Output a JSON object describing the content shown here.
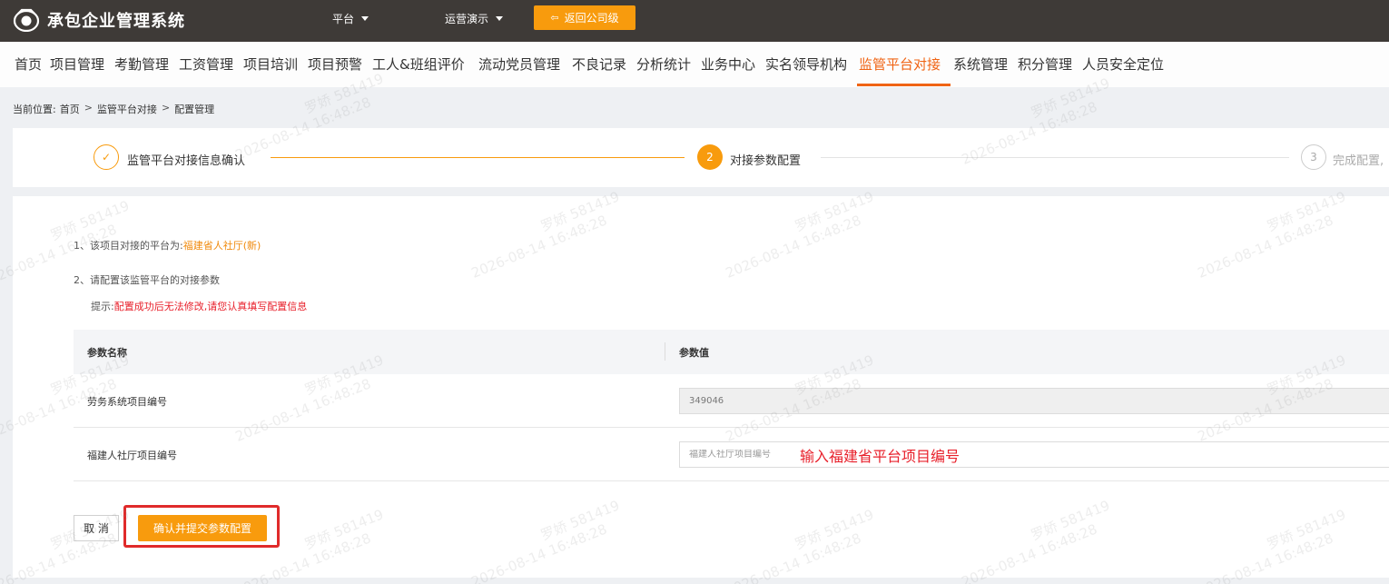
{
  "app": {
    "title": "承包企业管理系统",
    "logo_icon": "camera-logo-icon"
  },
  "topbar": {
    "platform_label": "平台",
    "demo_label": "运营演示",
    "back_button": "返回公司级"
  },
  "nav": {
    "items": [
      "首页",
      "项目管理",
      "考勤管理",
      "工资管理",
      "项目培训",
      "项目预警",
      "工人&班组评价",
      "流动党员管理",
      "不良记录",
      "分析统计",
      "业务中心",
      "实名领导机构",
      "监管平台对接",
      "系统管理",
      "积分管理",
      "人员安全定位"
    ],
    "active_index": 12
  },
  "breadcrumb": {
    "prefix": "当前位置:",
    "items": [
      "首页",
      "监管平台对接",
      "配置管理"
    ],
    "separator": ">"
  },
  "steps": [
    {
      "number": "✓",
      "label": "监管平台对接信息确认",
      "state": "done"
    },
    {
      "number": "2",
      "label": "对接参数配置",
      "state": "active"
    },
    {
      "number": "3",
      "label": "完成配置,",
      "state": "pending"
    }
  ],
  "content": {
    "line1_prefix": "1、该项目对接的平台为:",
    "line1_value": "福建省人社厅(新)",
    "line2": "2、请配置该监管平台的对接参数",
    "tip_prefix": "提示:",
    "tip_text": "配置成功后无法修改,请您认真填写配置信息"
  },
  "table": {
    "headers": [
      "参数名称",
      "参数值"
    ],
    "rows": [
      {
        "name": "劳务系统项目编号",
        "value": "349046",
        "disabled": true
      },
      {
        "name": "福建人社厅项目编号",
        "placeholder": "福建人社厅项目编号",
        "annotation": "输入福建省平台项目编号",
        "disabled": false
      }
    ]
  },
  "buttons": {
    "cancel": "取 消",
    "submit": "确认并提交参数配置"
  },
  "watermark": {
    "name": "罗娇 581419",
    "time": "2026-08-14 16:48:28"
  },
  "colors": {
    "topbar": "#3e3a37",
    "accent": "#f89b0d",
    "nav_active": "#f06414",
    "warning": "#e8202b"
  }
}
